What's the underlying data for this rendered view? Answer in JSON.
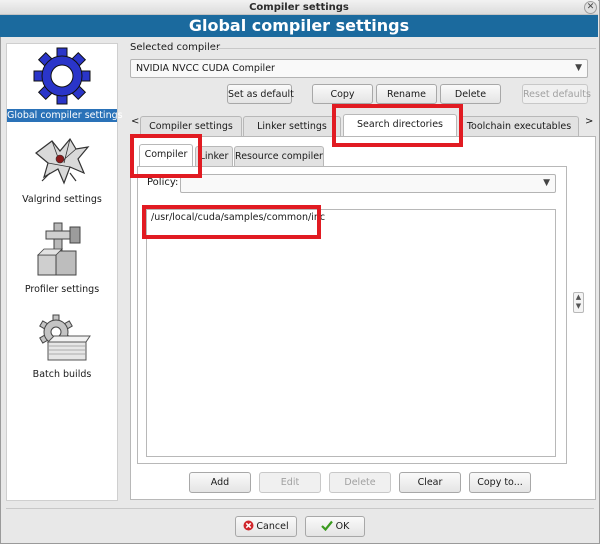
{
  "window": {
    "title": "Compiler settings",
    "close_glyph": "✕"
  },
  "header": {
    "title": "Global compiler settings"
  },
  "sidebar": {
    "items": [
      {
        "label": "Global compiler settings",
        "icon": "gear-icon",
        "selected": true
      },
      {
        "label": "Valgrind settings",
        "icon": "dragon-icon",
        "selected": false
      },
      {
        "label": "Profiler settings",
        "icon": "caliper-icon",
        "selected": false
      },
      {
        "label": "Batch builds",
        "icon": "batch-icon",
        "selected": false
      }
    ]
  },
  "compiler": {
    "group_label": "Selected compiler",
    "selected": "NVIDIA NVCC CUDA Compiler",
    "buttons": {
      "set_default": "Set as default",
      "copy": "Copy",
      "rename": "Rename",
      "delete": "Delete",
      "reset_defaults": "Reset defaults"
    }
  },
  "tabs": {
    "scroll_left": "<",
    "scroll_right": ">",
    "items": [
      "Compiler settings",
      "Linker settings",
      "Search directories",
      "Toolchain executables"
    ],
    "active": "Search directories"
  },
  "subtabs": {
    "items": [
      "Compiler",
      "Linker",
      "Resource compiler"
    ],
    "active": "Compiler"
  },
  "policy": {
    "label": "Policy:",
    "value": ""
  },
  "directories": [
    "/usr/local/cuda/samples/common/inc"
  ],
  "list_buttons": {
    "add": "Add",
    "edit": "Edit",
    "delete": "Delete",
    "clear": "Clear",
    "copy_to": "Copy to..."
  },
  "dialog_buttons": {
    "cancel": "Cancel",
    "ok": "OK"
  },
  "colors": {
    "header_bg": "#1b6a9e",
    "highlight": "#e11b22",
    "selection": "#2a72b8"
  }
}
